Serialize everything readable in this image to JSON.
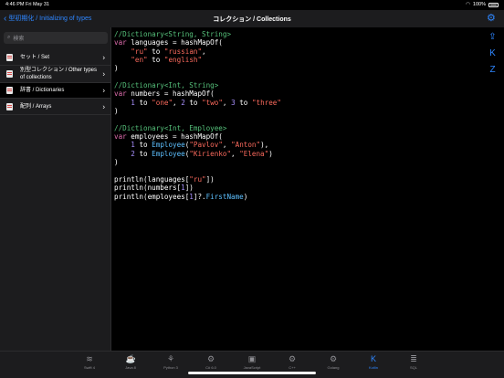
{
  "status": {
    "time": "4:46 PM",
    "date": "Fri May 31",
    "battery": "100%"
  },
  "nav": {
    "back_label": "型初期化 / Initializing of types",
    "title": "コレクション / Collections"
  },
  "sidebar": {
    "search_placeholder": "検索",
    "items": [
      {
        "label": "セット / Set",
        "selected": false
      },
      {
        "label": "別型コレクション / Other types of collections",
        "selected": false
      },
      {
        "label": "辞書 / Dictionaries",
        "selected": true
      },
      {
        "label": "配列 / Arrays",
        "selected": false
      }
    ]
  },
  "code": {
    "lines": [
      [
        [
          "c-comment",
          "//Dictionary<String, String>"
        ]
      ],
      [
        [
          "c-kw",
          "var"
        ],
        [
          "",
          " languages = hashMapOf("
        ]
      ],
      [
        [
          "",
          "    "
        ],
        [
          "c-str",
          "\"ru\""
        ],
        [
          "",
          " to "
        ],
        [
          "c-str",
          "\"russian\""
        ],
        [
          "",
          ","
        ]
      ],
      [
        [
          "",
          "    "
        ],
        [
          "c-str",
          "\"en\""
        ],
        [
          "",
          " to "
        ],
        [
          "c-str",
          "\"english\""
        ]
      ],
      [
        [
          "",
          ")"
        ]
      ],
      [
        [
          "",
          ""
        ]
      ],
      [
        [
          "c-comment",
          "//Dictionary<Int, String>"
        ]
      ],
      [
        [
          "c-kw",
          "var"
        ],
        [
          "",
          " numbers = hashMapOf("
        ]
      ],
      [
        [
          "",
          "    "
        ],
        [
          "c-num",
          "1"
        ],
        [
          "",
          " to "
        ],
        [
          "c-str",
          "\"one\""
        ],
        [
          "",
          ", "
        ],
        [
          "c-num",
          "2"
        ],
        [
          "",
          " to "
        ],
        [
          "c-str",
          "\"two\""
        ],
        [
          "",
          ", "
        ],
        [
          "c-num",
          "3"
        ],
        [
          "",
          " to "
        ],
        [
          "c-str",
          "\"three\""
        ]
      ],
      [
        [
          "",
          ")"
        ]
      ],
      [
        [
          "",
          ""
        ]
      ],
      [
        [
          "c-comment",
          "//Dictionary<Int, Employee>"
        ]
      ],
      [
        [
          "c-kw",
          "var"
        ],
        [
          "",
          " employees = hashMapOf("
        ]
      ],
      [
        [
          "",
          "    "
        ],
        [
          "c-num",
          "1"
        ],
        [
          "",
          " to "
        ],
        [
          "c-type",
          "Employee"
        ],
        [
          "",
          "("
        ],
        [
          "c-str",
          "\"Pavlov\""
        ],
        [
          "",
          ", "
        ],
        [
          "c-str",
          "\"Anton\""
        ],
        [
          "",
          "),"
        ]
      ],
      [
        [
          "",
          "    "
        ],
        [
          "c-num",
          "2"
        ],
        [
          "",
          " to "
        ],
        [
          "c-type",
          "Employee"
        ],
        [
          "",
          "("
        ],
        [
          "c-str",
          "\"Kirienko\""
        ],
        [
          "",
          ", "
        ],
        [
          "c-str",
          "\"Elena\""
        ],
        [
          "",
          ")"
        ]
      ],
      [
        [
          "",
          ")"
        ]
      ],
      [
        [
          "",
          ""
        ]
      ],
      [
        [
          "",
          "println(languages["
        ],
        [
          "c-str",
          "\"ru\""
        ],
        [
          "",
          "])"
        ]
      ],
      [
        [
          "",
          "println(numbers["
        ],
        [
          "c-num",
          "1"
        ],
        [
          "",
          "])"
        ]
      ],
      [
        [
          "",
          "println(employees["
        ],
        [
          "c-num",
          "1"
        ],
        [
          "",
          "]?."
        ],
        [
          "c-type",
          "FirstName"
        ],
        [
          "",
          ")"
        ]
      ]
    ]
  },
  "tabs": [
    {
      "label": "Swift 4",
      "icon": "swift-icon",
      "glyph": "≋"
    },
    {
      "label": "Java 8",
      "icon": "java-icon",
      "glyph": "☕"
    },
    {
      "label": "Python 3",
      "icon": "python-icon",
      "glyph": "⚘"
    },
    {
      "label": "C# 6.0",
      "icon": "csharp-icon",
      "glyph": "⚙"
    },
    {
      "label": "JavaScript",
      "icon": "javascript-icon",
      "glyph": "▣"
    },
    {
      "label": "C++",
      "icon": "cpp-icon",
      "glyph": "⚙"
    },
    {
      "label": "Golang",
      "icon": "golang-icon",
      "glyph": "⚙"
    },
    {
      "label": "Kotlin",
      "icon": "kotlin-icon",
      "glyph": "K",
      "active": true
    },
    {
      "label": "SQL",
      "icon": "sql-icon",
      "glyph": "≣"
    }
  ],
  "colors": {
    "accent": "#2e86ff",
    "comment": "#55c07a",
    "keyword": "#e46fb1",
    "string": "#fc6a5d",
    "number": "#a68ffa",
    "type": "#5dc0ff"
  }
}
